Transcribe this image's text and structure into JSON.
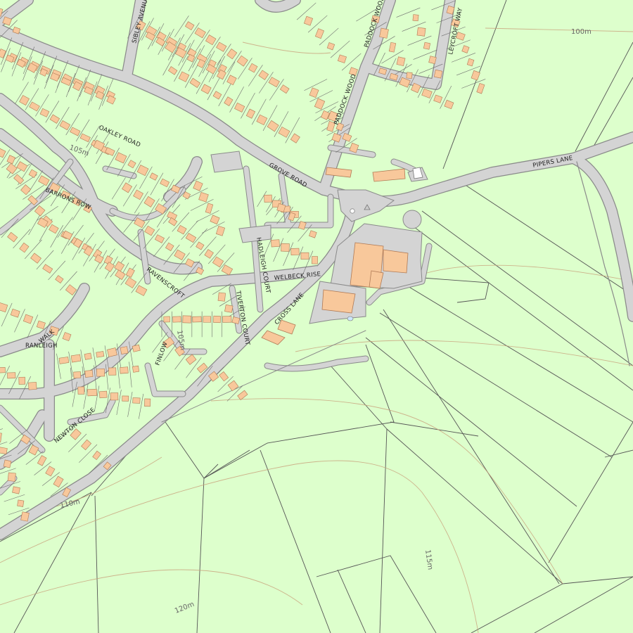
{
  "map": {
    "colors": {
      "background": "#ddffcc",
      "road": "#d4d4d4",
      "road_edge": "#8a8a8a",
      "building": "#f8c89b",
      "building_edge": "#b07a55",
      "field_line": "#555555",
      "contour": "#c9a17c",
      "plot_line": "#6e6e6e",
      "label": "#222222"
    },
    "road_labels": [
      "SIBLEY AVENUE",
      "PADDOCK WOOD",
      "LEYCROFT WAY",
      "OAKLEY ROAD",
      "GROVE ROAD",
      "PADDOCK WOOD",
      "PIPERS LANE",
      "BARRONS ROW",
      "HADLEIGH COURT",
      "WELBECK RISE",
      "RAVENSCROFT",
      "TIVERTON COURT",
      "CROSS LANE",
      "WALK",
      "RANLEIGH",
      "FINLOW",
      "NEWTON CLOSE"
    ],
    "contour_labels": [
      "100m",
      "105m",
      "110m",
      "115m",
      "120m",
      "105m"
    ],
    "icons": [
      "point-feature-icon",
      "triangle-marker-icon"
    ]
  }
}
